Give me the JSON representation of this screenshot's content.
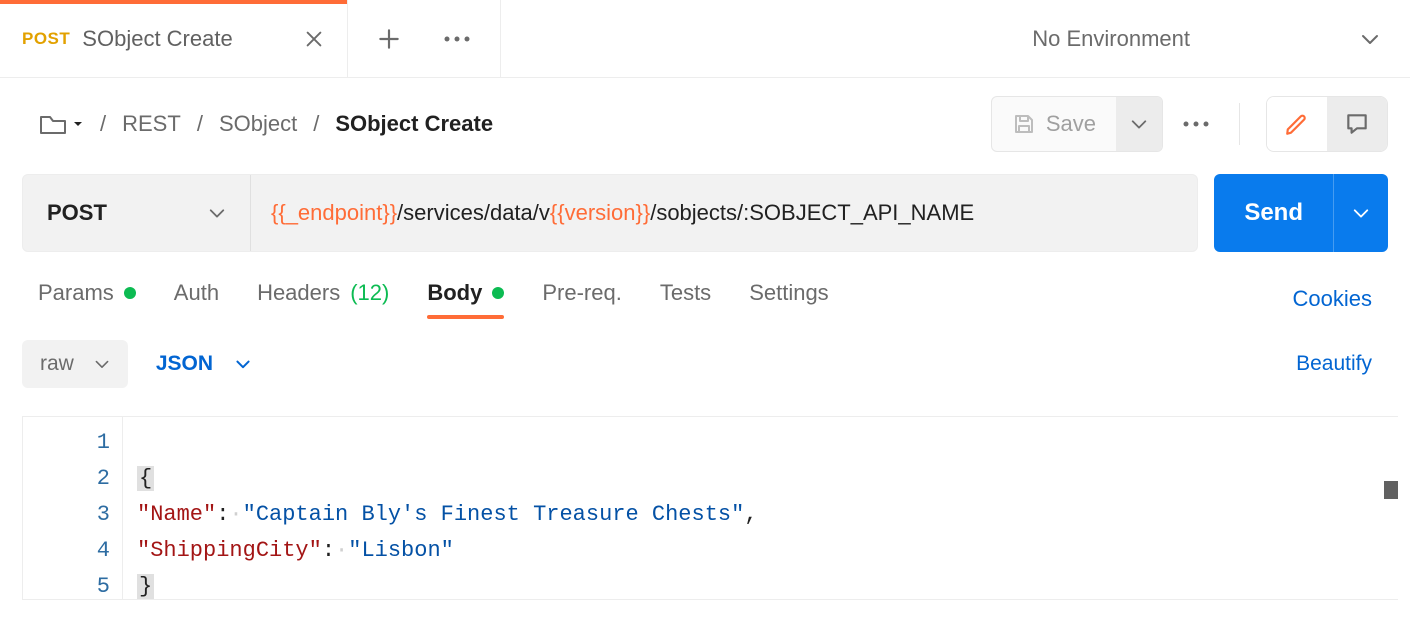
{
  "tab": {
    "method": "POST",
    "title": "SObject Create"
  },
  "environment": {
    "selected": "No Environment"
  },
  "breadcrumb": {
    "items": [
      "REST",
      "SObject",
      "SObject Create"
    ]
  },
  "toolbar": {
    "save_label": "Save"
  },
  "request": {
    "method": "POST",
    "url": {
      "var1": "{{_endpoint}}",
      "seg1": "/services/data/v",
      "var2": "{{version}}",
      "seg2": "/sobjects/:SOBJECT_API_NAME"
    },
    "send_label": "Send"
  },
  "reqtabs": {
    "params": "Params",
    "auth": "Auth",
    "headers_label": "Headers",
    "headers_count": "(12)",
    "body": "Body",
    "prereq": "Pre-req.",
    "tests": "Tests",
    "settings": "Settings",
    "cookies": "Cookies"
  },
  "body_controls": {
    "mode": "raw",
    "format": "JSON",
    "beautify": "Beautify"
  },
  "editor": {
    "line_numbers": [
      "1",
      "2",
      "3",
      "4",
      "5"
    ],
    "body_json": {
      "Name": "Captain Bly's Finest Treasure Chests",
      "ShippingCity": "Lisbon"
    },
    "tokens": {
      "brace_open": "{",
      "brace_close": "}",
      "k1": "\"Name\"",
      "v1": "\"Captain Bly's Finest Treasure Chests\"",
      "k2": "\"ShippingCity\"",
      "v2": "\"Lisbon\"",
      "colon": ":",
      "comma": ",",
      "dot": "·"
    }
  }
}
